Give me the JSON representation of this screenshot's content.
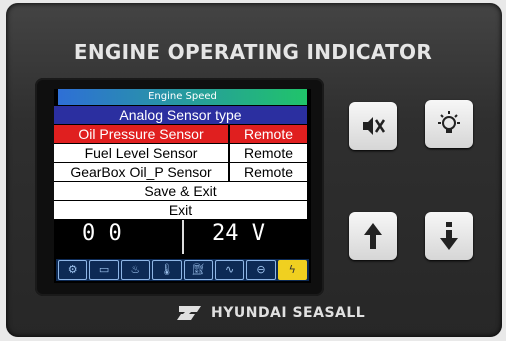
{
  "panel": {
    "title": "ENGINE OPERATING INDICATOR",
    "brand": "HYUNDAI SEASALL"
  },
  "screen": {
    "background_title": "Engine Speed",
    "background_left_value": "0 0",
    "background_right_value": "24 V",
    "menu": {
      "header": "Analog Sensor type",
      "rows": [
        {
          "label": "Oil Pressure Sensor",
          "value": "Remote",
          "selected": true
        },
        {
          "label": "Fuel Level Sensor",
          "value": "Remote",
          "selected": false
        },
        {
          "label": "GearBox Oil_P Sensor",
          "value": "Remote",
          "selected": false
        }
      ],
      "save_exit": "Save & Exit",
      "exit": "Exit"
    },
    "status_icons": [
      "engine-icon",
      "battery-icon",
      "oil-can-icon",
      "temperature-icon",
      "fuel-icon",
      "glow-plug-icon",
      "oil-level-icon",
      "charge-icon"
    ],
    "lit_icon": "charge-icon"
  },
  "buttons": [
    {
      "name": "mute-button",
      "icon": "mute-speaker-icon"
    },
    {
      "name": "lamp-test-button",
      "icon": "lamp-icon"
    },
    {
      "name": "up-button",
      "icon": "arrow-up-icon"
    },
    {
      "name": "down-button",
      "icon": "arrow-down-icon"
    }
  ],
  "colors": {
    "menu_header": "#2b2fa0",
    "selected_row": "#e01f1f",
    "panel": "#2f2f2f"
  }
}
